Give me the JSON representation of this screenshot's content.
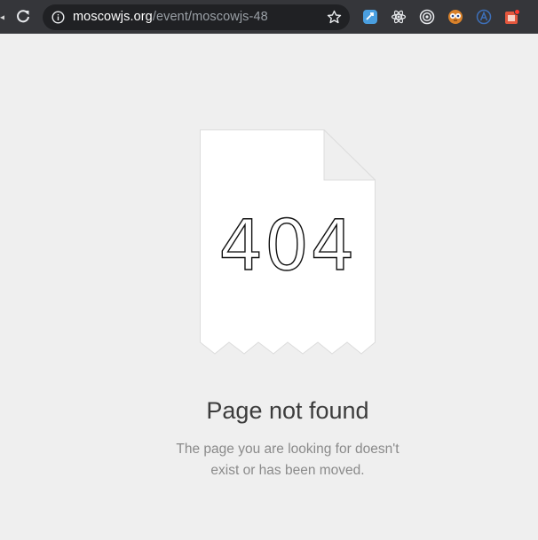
{
  "browser": {
    "url_host": "moscowjs.org",
    "url_path": "/event/moscowjs-48",
    "icons": [
      "reload-icon",
      "info-icon",
      "star-icon",
      "extension-icon",
      "react-devtools-icon",
      "target-icon",
      "owl-icon",
      "a-badge-icon",
      "notification-extension-icon"
    ]
  },
  "page": {
    "error_code": "404",
    "title": "Page not found",
    "description_line1": "The page you are looking for doesn't",
    "description_line2": "exist or has been moved."
  },
  "colors": {
    "toolbar": "#35363a",
    "omnibox": "#202124",
    "page_background": "#efefef",
    "title": "#3c3c3c",
    "description": "#8a8a8a"
  }
}
